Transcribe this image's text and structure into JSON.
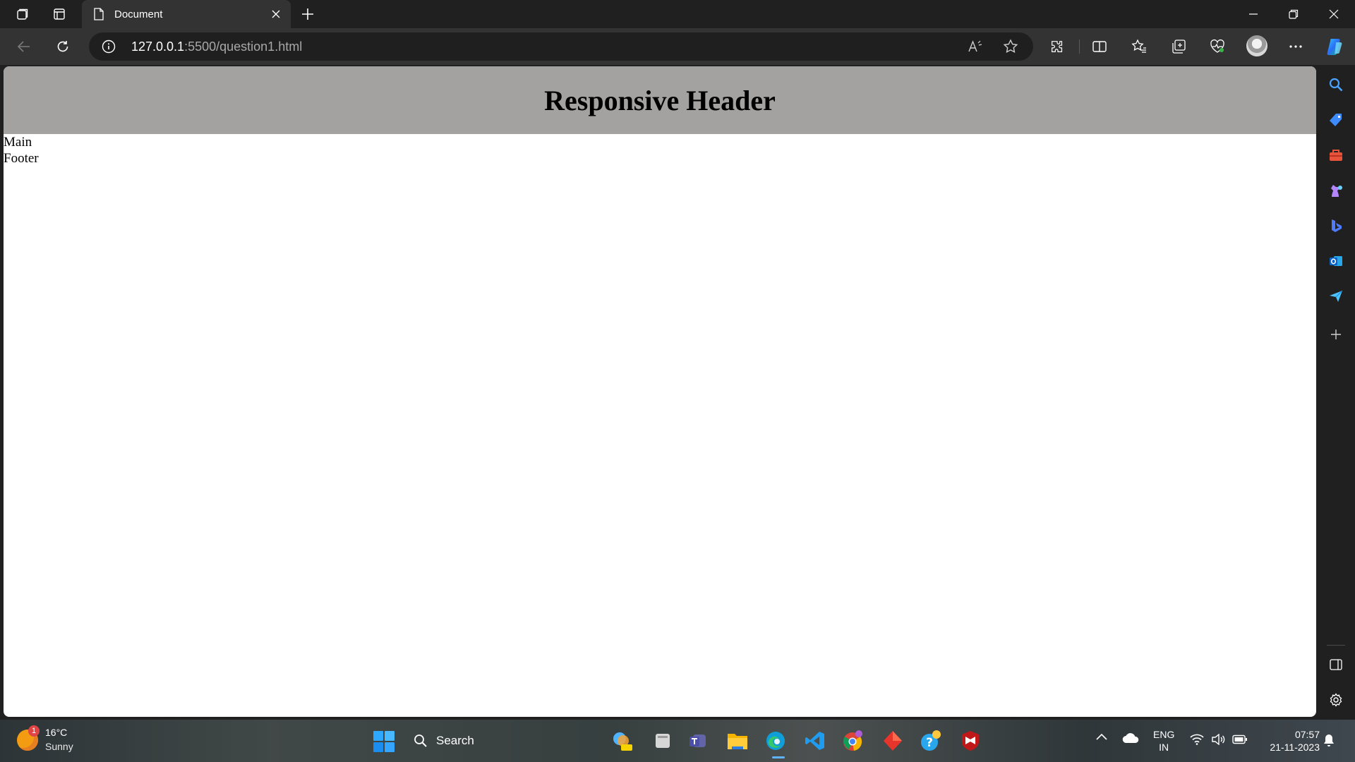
{
  "browser": {
    "tab": {
      "title": "Document"
    },
    "address": {
      "host": "127.0.0.1",
      "rest": ":5500/question1.html"
    }
  },
  "page": {
    "header": "Responsive Header",
    "main": "Main",
    "footer": "Footer"
  },
  "icons": {
    "titlebar": [
      "workspaces-icon",
      "tab-actions-icon",
      "document-icon",
      "close-icon",
      "plus-icon",
      "minimize-icon",
      "restore-icon",
      "window-close-icon"
    ],
    "toolbar": [
      "back-icon",
      "refresh-icon",
      "info-icon",
      "read-aloud-icon",
      "favorite-star-icon",
      "extensions-icon",
      "split-screen-icon",
      "favorites-icon",
      "collections-icon",
      "browser-essentials-icon",
      "profile-avatar",
      "more-icon",
      "copilot-icon"
    ],
    "sidebar": [
      "search-icon",
      "shopping-icon",
      "tools-icon",
      "games-icon",
      "bing-icon",
      "outlook-icon",
      "send-icon",
      "add-icon",
      "hide-sidebar-icon",
      "settings-icon"
    ]
  },
  "taskbar": {
    "weather": {
      "badge": "1",
      "temp": "16°C",
      "condition": "Sunny"
    },
    "search_label": "Search",
    "tray": {
      "lang_top": "ENG",
      "lang_bottom": "IN",
      "time": "07:57",
      "date": "21-11-2023"
    }
  }
}
